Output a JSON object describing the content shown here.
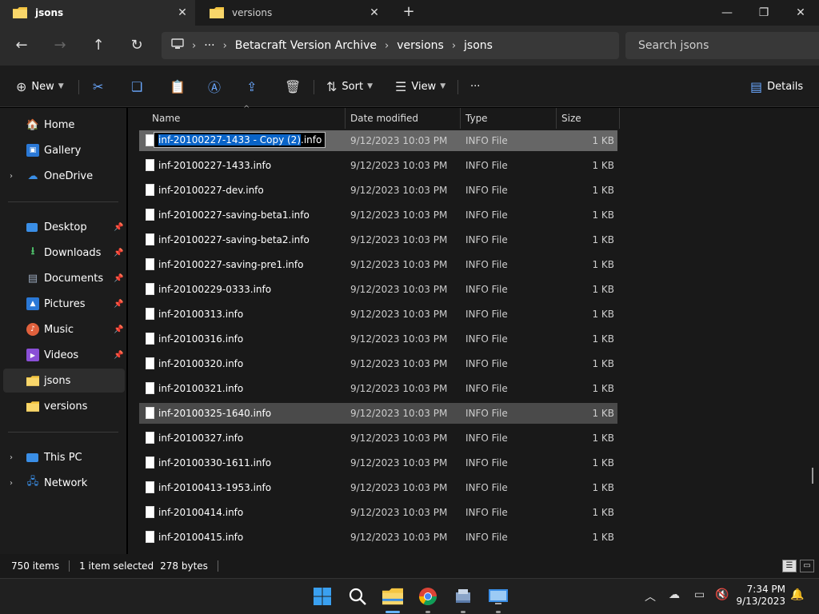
{
  "tabs": [
    {
      "label": "jsons",
      "active": true
    },
    {
      "label": "versions",
      "active": false
    }
  ],
  "new_tab_label": "+",
  "address": {
    "more": "···",
    "segments": [
      "Betacraft Version Archive",
      "versions",
      "jsons"
    ],
    "search_placeholder": "Search jsons"
  },
  "command_bar": {
    "new_label": "New",
    "sort_label": "Sort",
    "view_label": "View",
    "more_label": "···",
    "details_label": "Details"
  },
  "sidebar": {
    "top": [
      {
        "label": "Home",
        "icon": "home-icon"
      },
      {
        "label": "Gallery",
        "icon": "gallery-icon"
      },
      {
        "label": "OneDrive",
        "icon": "cloud-icon"
      }
    ],
    "quick": [
      {
        "label": "Desktop",
        "icon": "desktop-icon"
      },
      {
        "label": "Downloads",
        "icon": "download-icon"
      },
      {
        "label": "Documents",
        "icon": "document-icon"
      },
      {
        "label": "Pictures",
        "icon": "picture-icon"
      },
      {
        "label": "Music",
        "icon": "music-icon"
      },
      {
        "label": "Videos",
        "icon": "video-icon"
      },
      {
        "label": "jsons",
        "icon": "folder-icon"
      },
      {
        "label": "versions",
        "icon": "folder-icon"
      }
    ],
    "bottom": [
      {
        "label": "This PC",
        "icon": "computer-icon"
      },
      {
        "label": "Network",
        "icon": "network-icon"
      }
    ]
  },
  "columns": {
    "name": "Name",
    "date": "Date modified",
    "type": "Type",
    "size": "Size"
  },
  "rename": {
    "highlighted": "inf-20100227-1433 - Copy (2)",
    "rest": ".info"
  },
  "files": [
    {
      "name": "inf-20100227-1433 - Copy (2).info",
      "date": "9/12/2023 10:03 PM",
      "type": "INFO File",
      "size": "1 KB"
    },
    {
      "name": "inf-20100227-1433.info",
      "date": "9/12/2023 10:03 PM",
      "type": "INFO File",
      "size": "1 KB"
    },
    {
      "name": "inf-20100227-dev.info",
      "date": "9/12/2023 10:03 PM",
      "type": "INFO File",
      "size": "1 KB"
    },
    {
      "name": "inf-20100227-saving-beta1.info",
      "date": "9/12/2023 10:03 PM",
      "type": "INFO File",
      "size": "1 KB"
    },
    {
      "name": "inf-20100227-saving-beta2.info",
      "date": "9/12/2023 10:03 PM",
      "type": "INFO File",
      "size": "1 KB"
    },
    {
      "name": "inf-20100227-saving-pre1.info",
      "date": "9/12/2023 10:03 PM",
      "type": "INFO File",
      "size": "1 KB"
    },
    {
      "name": "inf-20100229-0333.info",
      "date": "9/12/2023 10:03 PM",
      "type": "INFO File",
      "size": "1 KB"
    },
    {
      "name": "inf-20100313.info",
      "date": "9/12/2023 10:03 PM",
      "type": "INFO File",
      "size": "1 KB"
    },
    {
      "name": "inf-20100316.info",
      "date": "9/12/2023 10:03 PM",
      "type": "INFO File",
      "size": "1 KB"
    },
    {
      "name": "inf-20100320.info",
      "date": "9/12/2023 10:03 PM",
      "type": "INFO File",
      "size": "1 KB"
    },
    {
      "name": "inf-20100321.info",
      "date": "9/12/2023 10:03 PM",
      "type": "INFO File",
      "size": "1 KB"
    },
    {
      "name": "inf-20100325-1640.info",
      "date": "9/12/2023 10:03 PM",
      "type": "INFO File",
      "size": "1 KB"
    },
    {
      "name": "inf-20100327.info",
      "date": "9/12/2023 10:03 PM",
      "type": "INFO File",
      "size": "1 KB"
    },
    {
      "name": "inf-20100330-1611.info",
      "date": "9/12/2023 10:03 PM",
      "type": "INFO File",
      "size": "1 KB"
    },
    {
      "name": "inf-20100413-1953.info",
      "date": "9/12/2023 10:03 PM",
      "type": "INFO File",
      "size": "1 KB"
    },
    {
      "name": "inf-20100414.info",
      "date": "9/12/2023 10:03 PM",
      "type": "INFO File",
      "size": "1 KB"
    },
    {
      "name": "inf-20100415.info",
      "date": "9/12/2023 10:03 PM",
      "type": "INFO File",
      "size": "1 KB"
    }
  ],
  "status": {
    "items": "750 items",
    "selected": "1 item selected",
    "size": "278 bytes"
  },
  "clock": {
    "time": "7:34 PM",
    "date": "9/13/2023"
  },
  "colors": {
    "accent": "#0a64c8",
    "folder": "#f4c542",
    "taskbar_active": "#66b3ff"
  }
}
